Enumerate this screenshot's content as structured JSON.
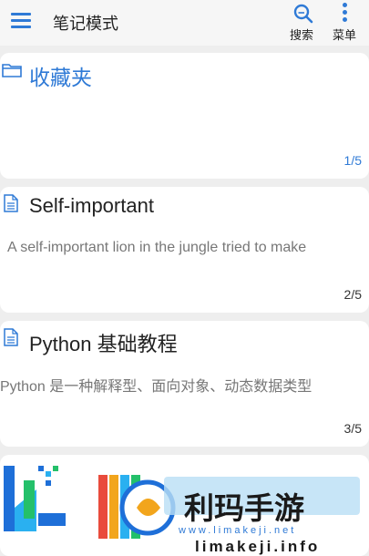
{
  "topbar": {
    "title": "笔记模式",
    "search_label": "搜索",
    "menu_label": "菜单",
    "menu_icon": "hamburger-icon",
    "search_icon": "search-icon",
    "more_icon": "more-vertical-icon"
  },
  "cards": [
    {
      "title": "收藏夹",
      "icon": "folder-icon",
      "snippet": "",
      "count": "1/5"
    },
    {
      "title": "Self-important",
      "icon": "document-icon",
      "snippet": "A self-important lion in the jungle tried to make",
      "count": "2/5"
    },
    {
      "title": "Python 基础教程",
      "icon": "document-icon",
      "snippet": "Python 是一种解释型、面向对象、动态数据类型",
      "count": "3/5"
    }
  ],
  "watermark": {
    "brand": "利玛手游",
    "url_small": "www.limakeji.net",
    "url": "limakeji.info"
  },
  "colors": {
    "accent": "#2f7ad6",
    "background": "#eeeeee",
    "card": "#ffffff"
  }
}
